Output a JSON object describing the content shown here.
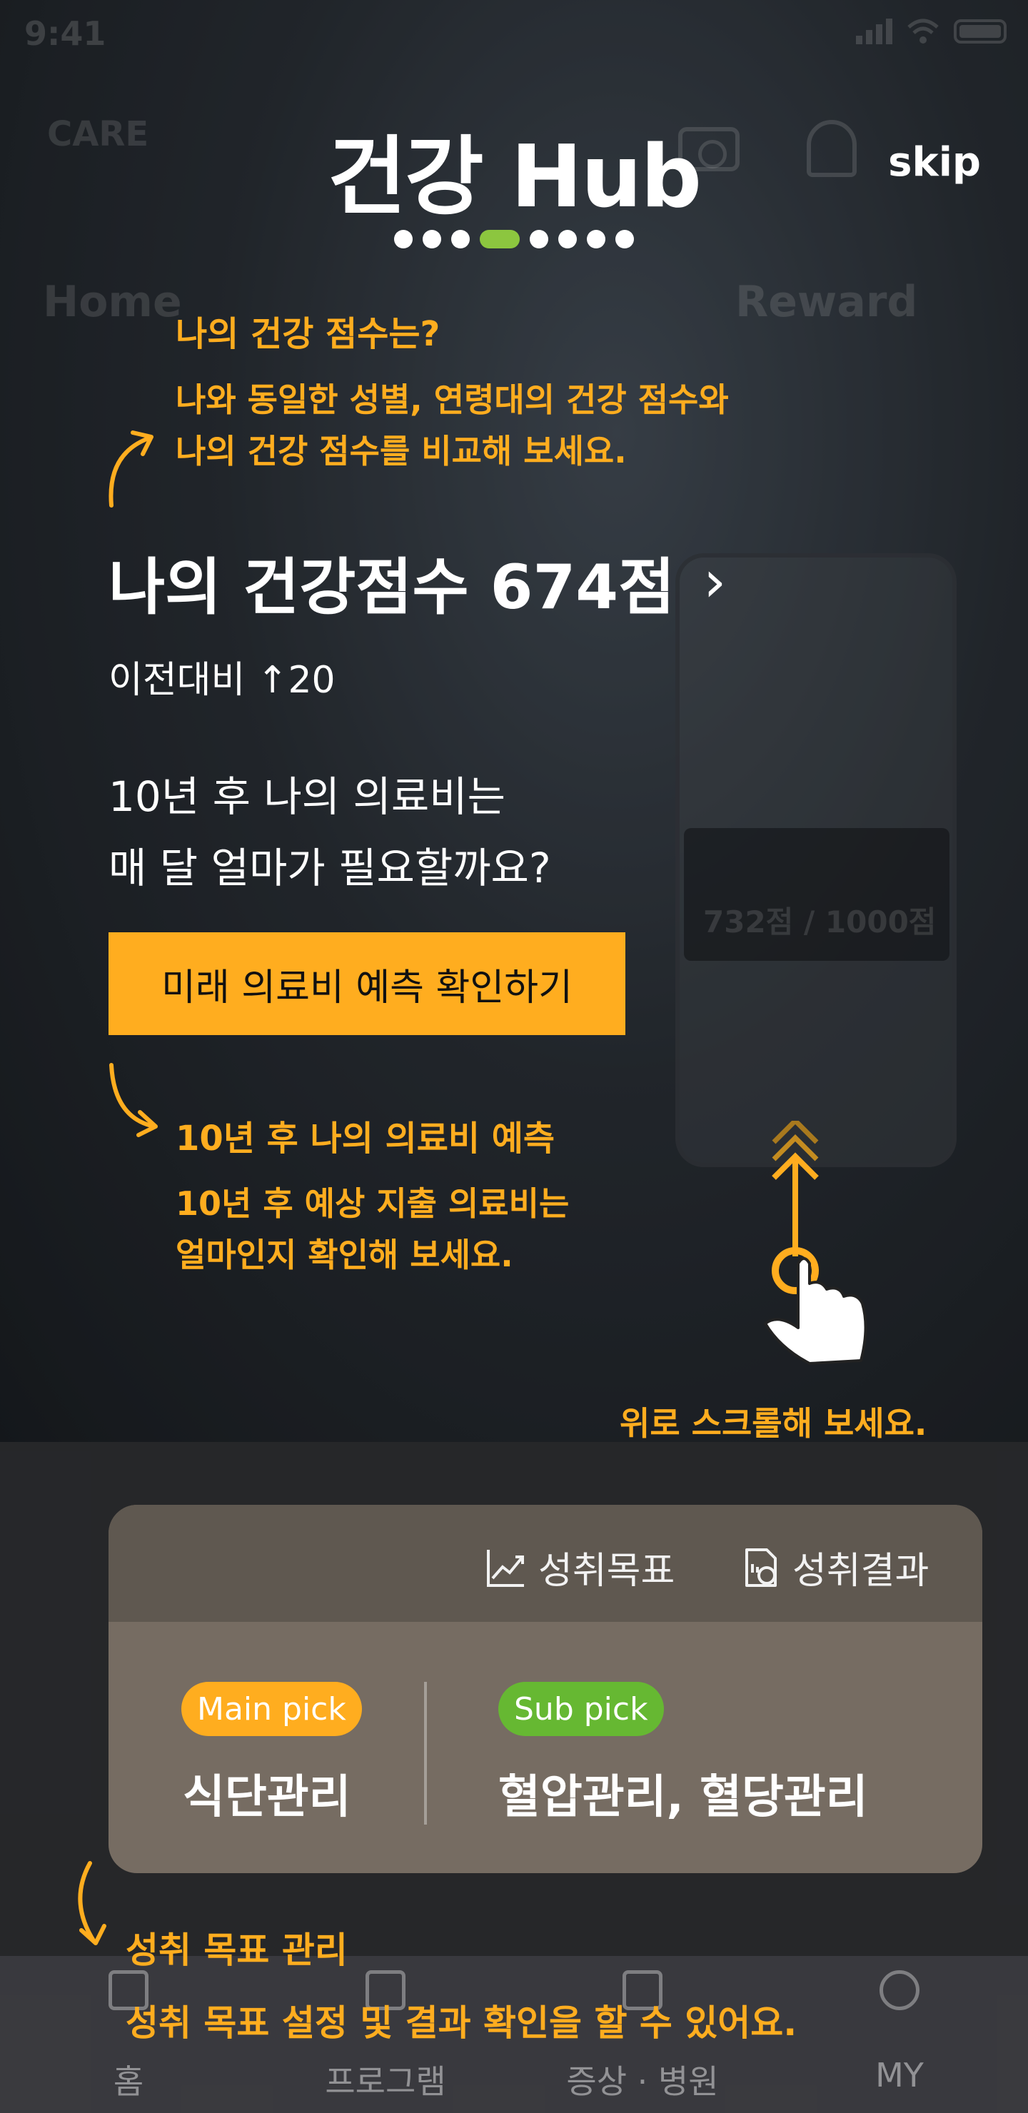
{
  "status_bar": {
    "time": "9:41"
  },
  "background": {
    "logo": "CARE",
    "ghost_left": "Home",
    "ghost_right": "Reward",
    "phone_score": "732점 / 1000점"
  },
  "header": {
    "title": "건강 Hub",
    "skip": "skip",
    "pager_total": 8,
    "pager_active_index": 3
  },
  "coach1": {
    "title": "나의 건강 점수는?",
    "desc_line1": "나와 동일한 성별, 연령대의 건강 점수와",
    "desc_line2": "나의 건강 점수를 비교해 보세요."
  },
  "score": {
    "label": "나의 건강점수 674점",
    "chevron": "›",
    "compare": "이전대비 ↑20"
  },
  "question": {
    "line1": "10년 후 나의 의료비는",
    "line2": "매 달 얼마가 필요할까요?"
  },
  "predict_button": "미래 의료비 예측 확인하기",
  "coach2": {
    "title": "10년 후 나의 의료비 예측",
    "desc_line1": "10년 후 예상 지출 의료비는",
    "desc_line2": "얼마인지 확인해 보세요."
  },
  "scroll_hint": "위로 스크롤해 보세요.",
  "card": {
    "goal_link": "성취목표",
    "result_link": "성취결과",
    "main_badge": "Main pick",
    "main_value": "식단관리",
    "sub_badge": "Sub pick",
    "sub_value": "혈압관리, 혈당관리"
  },
  "coach3": {
    "title": "성취 목표 관리",
    "desc": "성취 목표 설정 및 결과 확인을 할 수 있어요."
  },
  "nav": [
    "홈",
    "프로그램",
    "증상 · 병원",
    "MY"
  ],
  "colors": {
    "accent_orange": "#ffad1f",
    "accent_green": "#8cc63f",
    "card_bg": "#766c62",
    "card_header_bg": "#5f5850"
  }
}
